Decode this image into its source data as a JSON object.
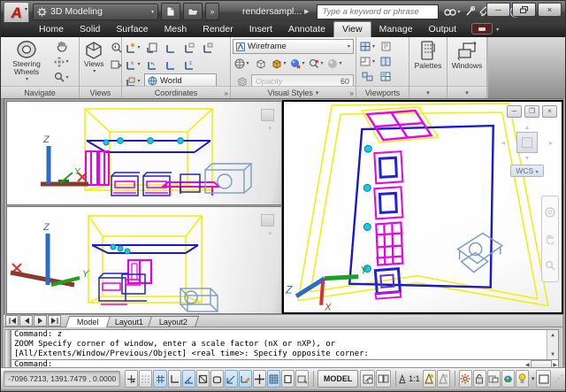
{
  "titlebar": {
    "workspace": "3D Modeling",
    "filename": "rendersampl...",
    "search_placeholder": "Type a keyword or phrase"
  },
  "ribbon": {
    "tabs": [
      "Home",
      "Solid",
      "Surface",
      "Mesh",
      "Render",
      "Insert",
      "Annotate",
      "View",
      "Manage",
      "Output"
    ],
    "active_tab": "View",
    "navigate": {
      "label": "Navigate",
      "steering_wheels": "Steering Wheels"
    },
    "views": {
      "label": "Views",
      "views_button": "Views"
    },
    "coordinates": {
      "label": "Coordinates",
      "world": "World"
    },
    "visual_styles": {
      "label": "Visual Styles",
      "current_style": "Wireframe",
      "opacity_placeholder": "Opacity",
      "opacity_value": "60"
    },
    "viewports": {
      "label": "Viewports"
    },
    "palettes": {
      "label": "Palettes"
    },
    "windows": {
      "label": "Windows"
    }
  },
  "viewport": {
    "wcs": "WCS",
    "ucs_x": "X",
    "ucs_y": "Y",
    "ucs_z": "Z"
  },
  "layout_tabs": [
    "Model",
    "Layout1",
    "Layout2"
  ],
  "command": {
    "line1": "Command: z",
    "line2": "ZOOM Specify corner of window, enter a scale factor (nX or nXP), or",
    "line3": "[All/Extents/Window/Previous/Object] <real time>: Specify opposite corner:",
    "prompt": "Command:"
  },
  "statusbar": {
    "coordinates": "-7096.7213, 1391.7479 , 0.0000",
    "model": "MODEL",
    "annotation_scale": "1:1"
  },
  "colors": {
    "wire_yellow": "#f0f000",
    "wire_blue": "#1a1acc",
    "wire_magenta": "#e800e8",
    "wire_cyan": "#1ac8e8",
    "wire_steel": "#7b9cc8",
    "ucs_green": "#1f9e1f",
    "ucs_red": "#d93030",
    "ucs_blue": "#2b6cc8",
    "ucs_brown": "#8b3a2a"
  }
}
